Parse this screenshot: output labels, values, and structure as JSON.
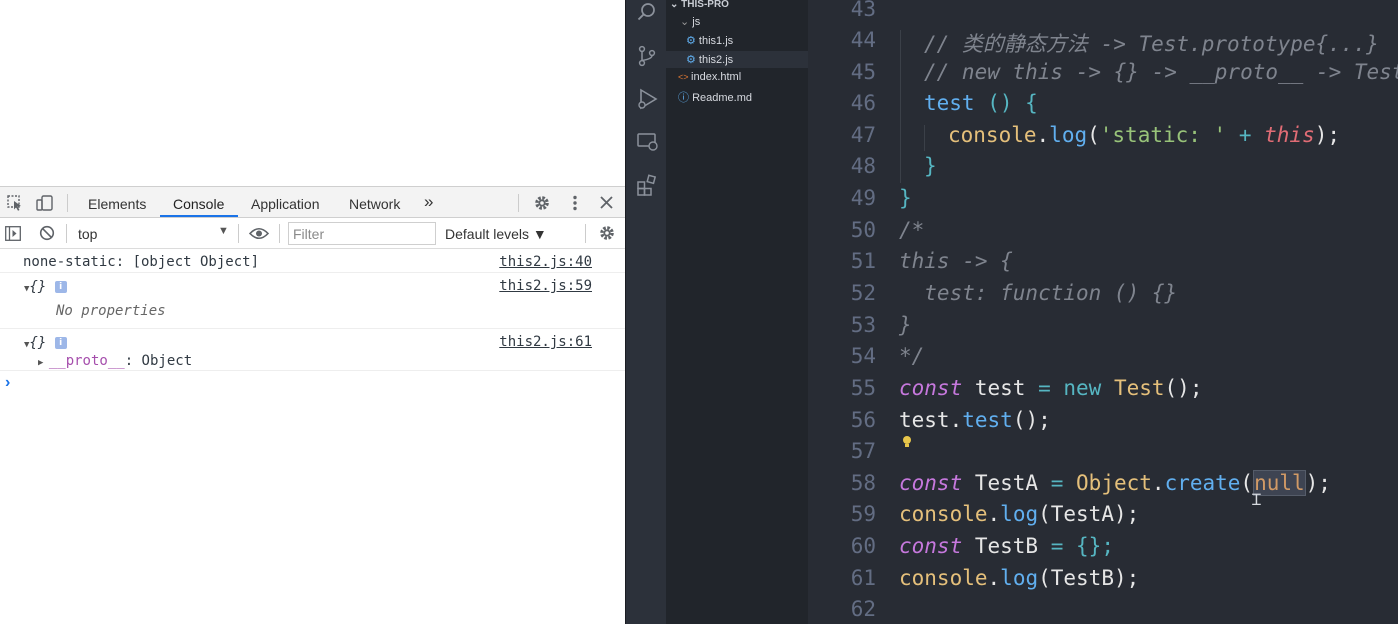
{
  "devtools": {
    "tabs": [
      "Elements",
      "Console",
      "Application",
      "Network"
    ],
    "more_tabs": "»",
    "context": "top",
    "filter_placeholder": "Filter",
    "levels_label": "Default levels ▼",
    "console_rows": [
      {
        "text": "none-static: [object Object]",
        "source": "this2.js:40"
      },
      {
        "text": "{}",
        "source": "this2.js:59",
        "child": "No properties"
      },
      {
        "text": "{}",
        "source": "this2.js:61",
        "child_key": "__proto__",
        "child_val": ": Object"
      }
    ],
    "prompt": "›"
  },
  "explorer": {
    "root": "THIS-PRO",
    "folder": "js",
    "files": [
      "this1.js",
      "this2.js",
      "index.html",
      "Readme.md"
    ]
  },
  "editor": {
    "line_numbers": [
      "43",
      "44",
      "45",
      "46",
      "47",
      "48",
      "49",
      "50",
      "51",
      "52",
      "53",
      "54",
      "55",
      "56",
      "57",
      "58",
      "59",
      "60",
      "61",
      "62"
    ],
    "lines": {
      "l44": "// 类的静态方法 -> Test.prototype{...}",
      "l45": "// new this -> {} -> __proto__ -> Test",
      "l46_name": "test",
      "l46_rest": " () {",
      "l47_obj": "console",
      "l47_dot": ".",
      "l47_fn": "log",
      "l47_p1": "(",
      "l47_str": "'static: '",
      "l47_plus": " + ",
      "l47_this": "this",
      "l47_end": ");",
      "l48": "}",
      "l49": "}",
      "l50": "/*",
      "l51": "this -> {",
      "l52": "  test: function () {}",
      "l53": "}",
      "l54": "*/",
      "l55_const": "const",
      "l55_name": " test ",
      "l55_eq": "=",
      "l55_new": " new ",
      "l55_cls": "Test",
      "l55_end": "();",
      "l56_obj": "test",
      "l56_dot": ".",
      "l56_fn": "test",
      "l56_end": "();",
      "l58_const": "const",
      "l58_name": " TestA ",
      "l58_eq": "=",
      "l58_obj": " Object",
      "l58_dot": ".",
      "l58_fn": "create",
      "l58_p": "(",
      "l58_null": "null",
      "l58_end": ");",
      "l59_obj": "console",
      "l59_dot": ".",
      "l59_fn": "log",
      "l59_arg": "(TestA);",
      "l60_const": "const",
      "l60_name": " TestB ",
      "l60_eq": "=",
      "l60_val": " {};",
      "l61_obj": "console",
      "l61_dot": ".",
      "l61_fn": "log",
      "l61_arg": "(TestB);"
    }
  },
  "colors": {
    "editor_bg": "#282c34",
    "sidebar_bg": "#21252b",
    "devtools_accent": "#1a73e8"
  }
}
